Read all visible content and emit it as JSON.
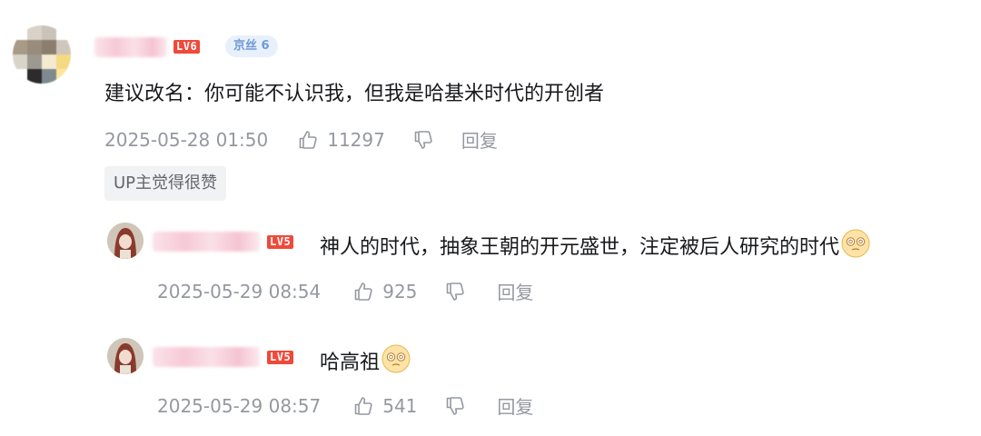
{
  "main_comment": {
    "level_badge": "LV6",
    "fan_badge": "京丝 6",
    "text": "建议改名：你可能不认识我，但我是哈基米时代的开创者",
    "timestamp": "2025-05-28 01:50",
    "like_count": "11297",
    "reply_label": "回复",
    "up_tag": "UP主觉得很赞"
  },
  "replies": [
    {
      "level_badge": "LV5",
      "text": "神人的时代，抽象王朝的开元盛世，注定被后人研究的时代",
      "timestamp": "2025-05-29 08:54",
      "like_count": "925",
      "reply_label": "回复"
    },
    {
      "level_badge": "LV5",
      "text": "哈高祖",
      "timestamp": "2025-05-29 08:57",
      "like_count": "541",
      "reply_label": "回复"
    }
  ],
  "colors": {
    "level_badge": "#f0493a",
    "fan_badge_bg": "#e8f0fb",
    "fan_badge_text": "#6f9bd6",
    "meta_text": "#9499a0",
    "body_text": "#18191c"
  },
  "icons": {
    "like": "thumbs-up-icon",
    "dislike": "thumbs-down-icon",
    "emoji": "dizzy-face-emoji"
  }
}
